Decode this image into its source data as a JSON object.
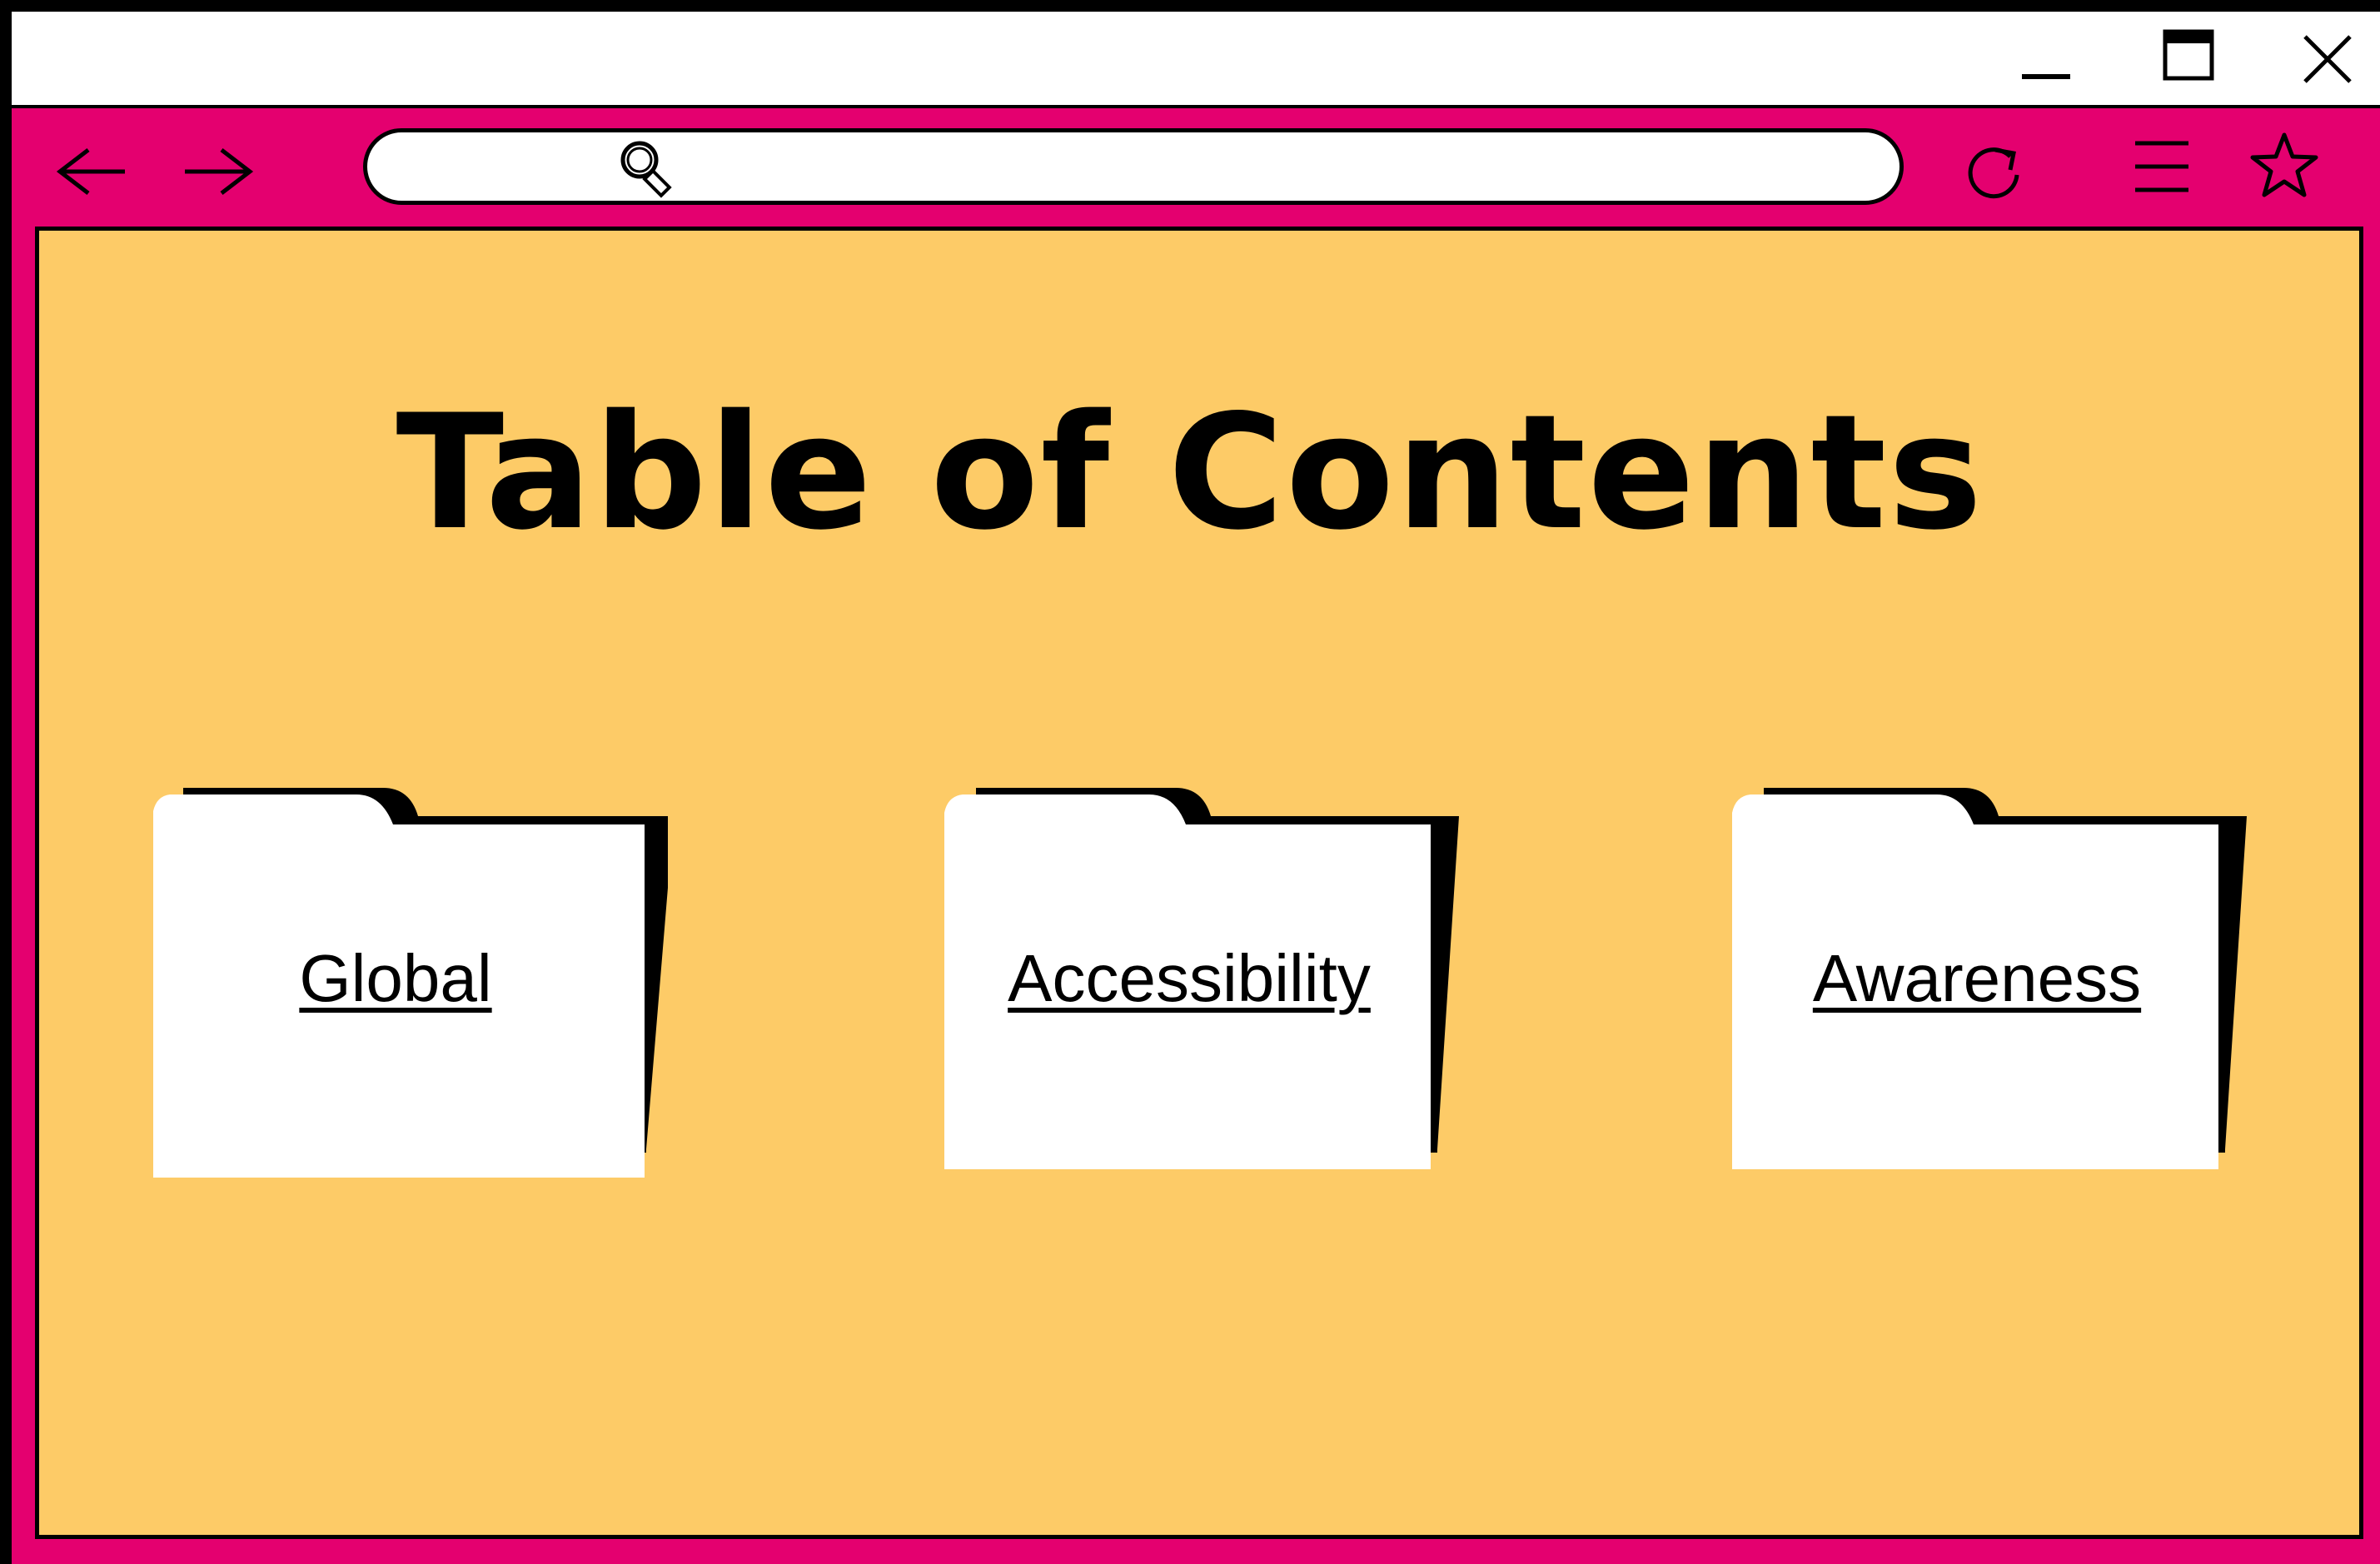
{
  "browser": {
    "window_controls": {
      "minimize_icon": "minimize-icon",
      "maximize_icon": "maximize-icon",
      "close_icon": "close-icon"
    },
    "toolbar": {
      "back_icon": "arrow-left-icon",
      "forward_icon": "arrow-right-icon",
      "address_value": "",
      "search_icon": "search-icon",
      "reload_icon": "reload-icon",
      "menu_icon": "hamburger-menu-icon",
      "bookmark_icon": "star-icon"
    }
  },
  "page": {
    "title": "Table of Contents",
    "folders": [
      {
        "label": "Global"
      },
      {
        "label": "Accessibility"
      },
      {
        "label": "Awareness"
      }
    ]
  },
  "colors": {
    "toolbar_pink": "#e4006f",
    "content_background": "#fdcb67",
    "titlebar_white": "#ffffff",
    "outline_black": "#000000"
  }
}
